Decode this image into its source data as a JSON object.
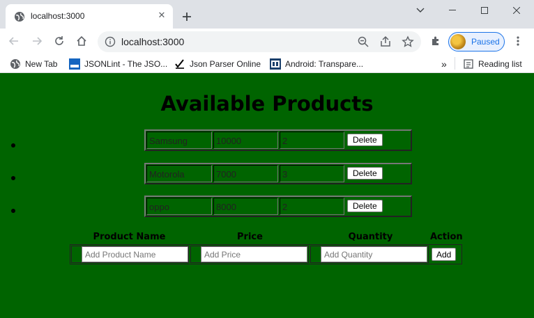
{
  "browser": {
    "tab_title": "localhost:3000",
    "url": "localhost:3000",
    "profile_label": "Paused",
    "bookmarks": [
      {
        "label": "New Tab",
        "icon": "globe-icon"
      },
      {
        "label": "JSONLint - The JSO...",
        "icon": "jsonlint-icon"
      },
      {
        "label": "Json Parser Online",
        "icon": "json-parser-icon"
      },
      {
        "label": "Android: Transpare...",
        "icon": "android-41-icon"
      }
    ],
    "reading_list": "Reading list",
    "more_bookmarks": "»"
  },
  "page": {
    "title": "Available Products",
    "products": [
      {
        "name": "Samsung",
        "price": "10000",
        "quantity": "2",
        "action": "Delete"
      },
      {
        "name": "Motorola",
        "price": "7000",
        "quantity": "3",
        "action": "Delete"
      },
      {
        "name": "oppo",
        "price": "8000",
        "quantity": "2",
        "action": "Delete"
      }
    ],
    "form": {
      "headers": {
        "name": "Product Name",
        "price": "Price",
        "quantity": "Quantity",
        "action": "Action"
      },
      "name_placeholder": "Add Product Name",
      "price_placeholder": "Add Price",
      "quantity_placeholder": "Add Quantity",
      "add_label": "Add"
    }
  }
}
